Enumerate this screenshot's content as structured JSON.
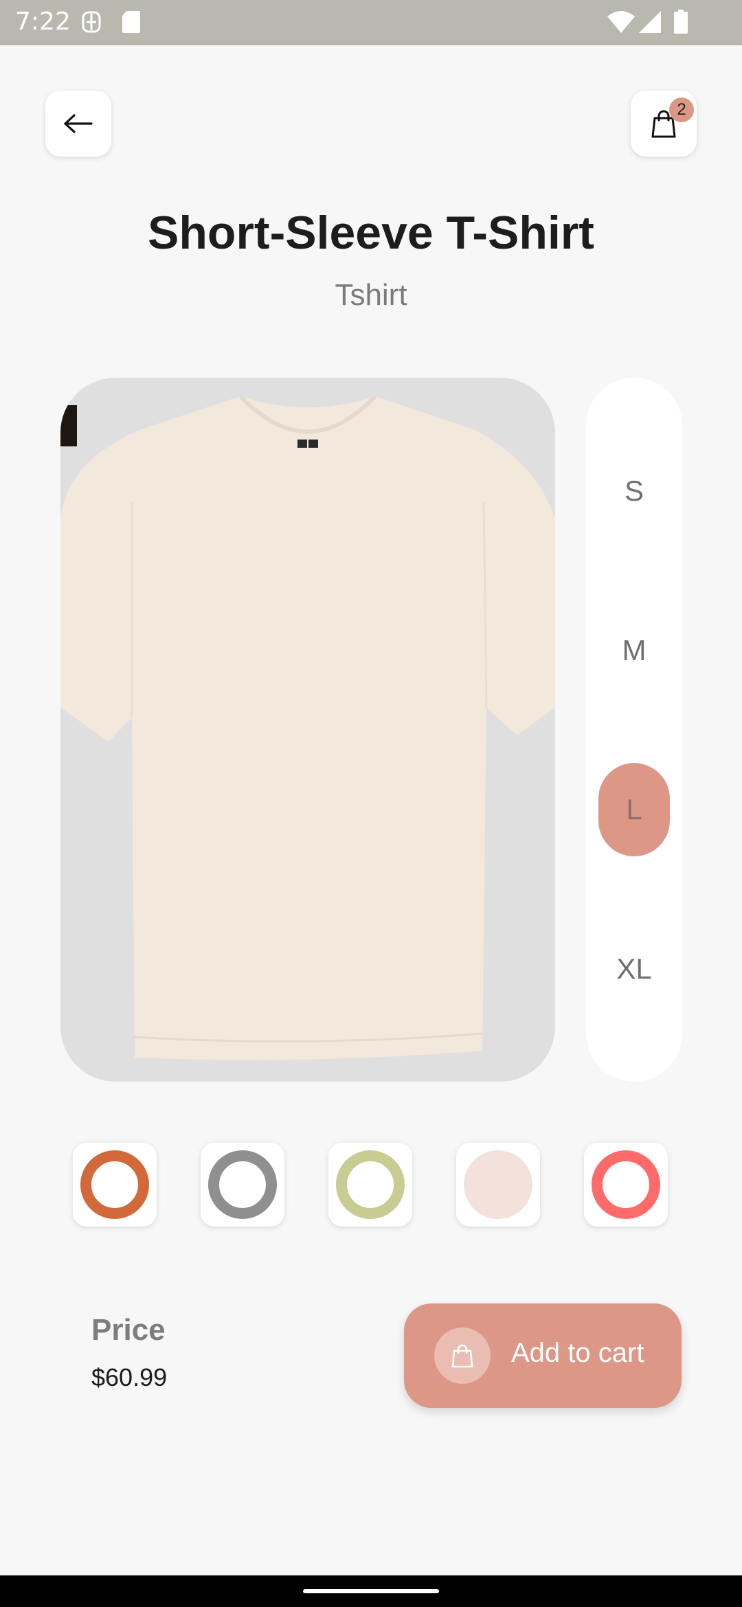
{
  "status_bar": {
    "time": "7:22"
  },
  "header": {
    "cart_count": "2"
  },
  "product": {
    "name": "Short-Sleeve T-Shirt",
    "category": "Tshirt",
    "image_icon": "tshirt-image",
    "shirt_color": "#f3e8dc",
    "card_color": "#e0dfe0"
  },
  "sizes": [
    {
      "label": "S",
      "selected": false
    },
    {
      "label": "M",
      "selected": false
    },
    {
      "label": "L",
      "selected": true
    },
    {
      "label": "XL",
      "selected": false
    }
  ],
  "colors": [
    "#d2693a",
    "#8f8f8f",
    "#c9cc92",
    "#f3e2dc",
    "#ff6b6b"
  ],
  "price": {
    "label": "Price",
    "value": "$60.99"
  },
  "cta": {
    "label": "Add to cart"
  },
  "accent": "#dc9787"
}
